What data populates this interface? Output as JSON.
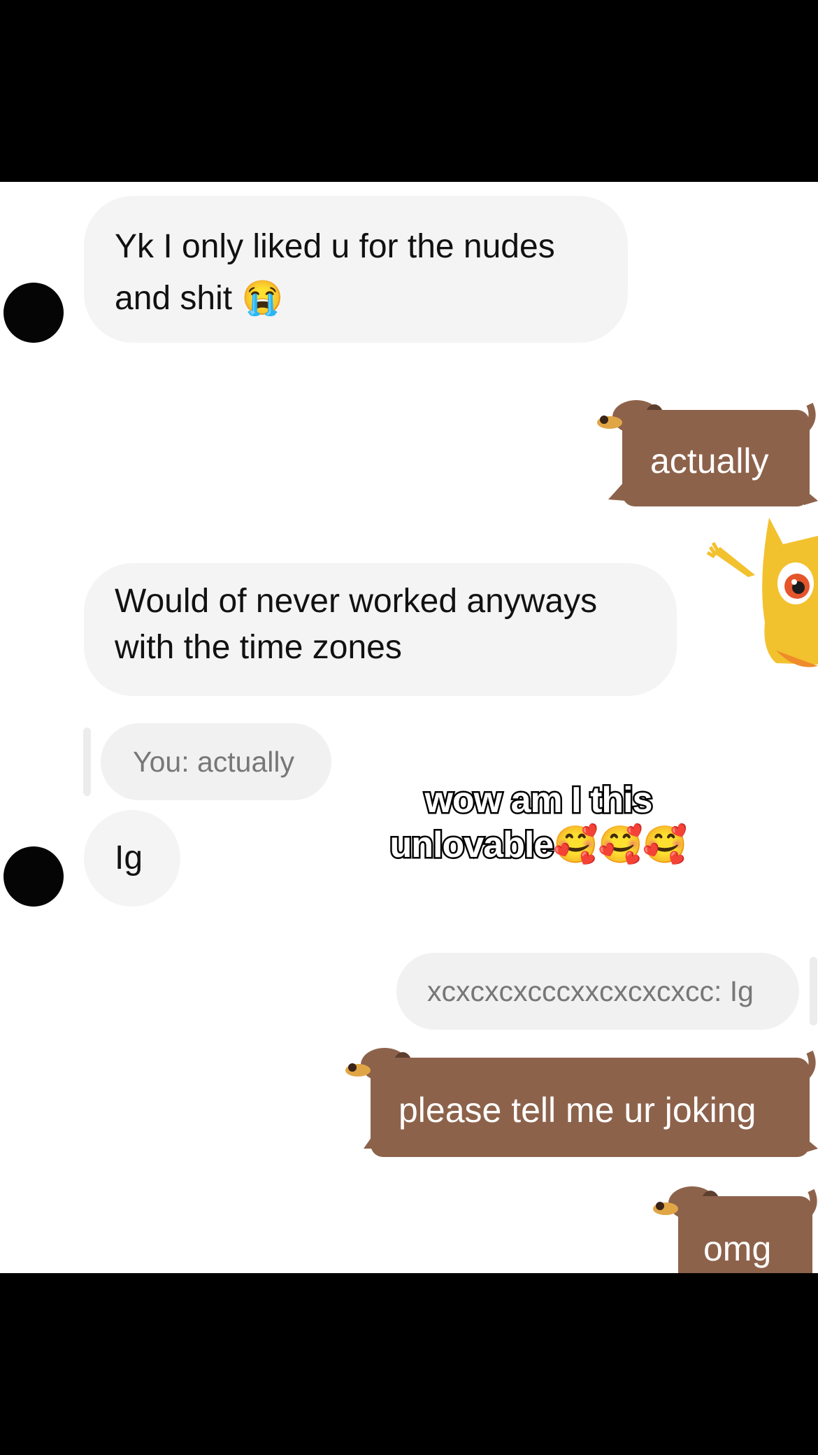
{
  "messages": {
    "m1": {
      "text_line1": "Yk I only liked u for the nudes",
      "text_line2": "and shit",
      "emoji": "😭"
    },
    "m2": {
      "text": "actually"
    },
    "m3": {
      "text_line1": "Would of never worked anyways",
      "text_line2": "with the time zones"
    },
    "m4_reply": {
      "text": "You: actually"
    },
    "m4": {
      "text": "Ig"
    },
    "m5_reply": {
      "text": "xcxcxcxcccxxcxcxcxcc: Ig"
    },
    "m5": {
      "text": "please tell me ur joking"
    },
    "m6": {
      "text": "omg"
    }
  },
  "overlay": {
    "caption_line1": "wow am I this",
    "caption_line2": "unlovable",
    "caption_emoji": "🥰🥰🥰"
  },
  "colors": {
    "incoming_bubble": "#f4f4f4",
    "dog_sticker": "#8d624b",
    "background": "#ffffff",
    "letterbox": "#000000"
  },
  "icons": [
    "avatar",
    "dachshund-sticker",
    "yellow-mascot-sticker"
  ]
}
